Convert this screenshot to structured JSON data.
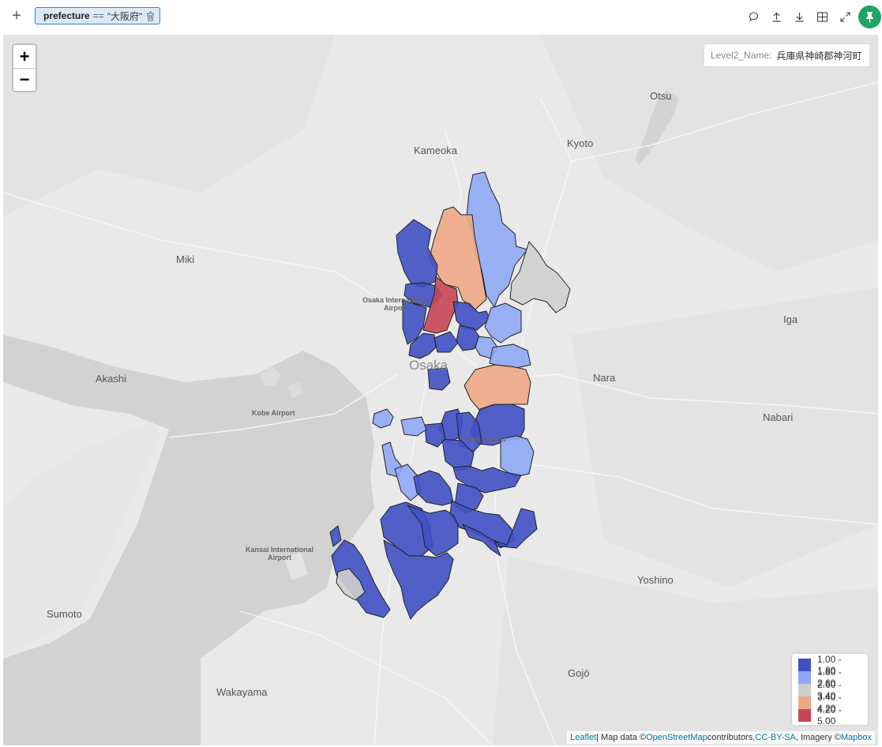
{
  "toolbar": {
    "add_label": "+",
    "filter": {
      "column": "prefecture",
      "operator": "==",
      "value": "\"大阪府\""
    },
    "icons": [
      "comment-icon",
      "upload-icon",
      "download-icon",
      "grid-icon",
      "expand-icon",
      "pin-icon"
    ]
  },
  "map": {
    "zoom_in": "+",
    "zoom_out": "−",
    "hover": {
      "key": "Level2_Name:",
      "value": "兵庫県神崎郡神河町"
    },
    "places": {
      "otsu": "Otsu",
      "kameoka": "Kameoka",
      "kyoto": "Kyoto",
      "miki": "Miki",
      "iga": "Iga",
      "osaka": "Osaka",
      "akashi": "Akashi",
      "nara": "Nara",
      "nabari": "Nabari",
      "kobe_airport": "Kobe Airport",
      "osaka_airport_1": "Osaka International",
      "osaka_airport_2": "Airport",
      "yao_airport": "Yao Airport",
      "kansai_airport_1": "Kansai International",
      "kansai_airport_2": "Airport",
      "yoshino": "Yoshino",
      "sumoto": "Sumoto",
      "gojo": "Gojō",
      "wakayama": "Wakayama"
    },
    "legend": [
      {
        "label": "1.00 - 1.80",
        "color": "#3f51c4"
      },
      {
        "label": "1.80 - 2.60",
        "color": "#8fa8f5"
      },
      {
        "label": "2.60 - 3.40",
        "color": "#cfcfcf"
      },
      {
        "label": "3.40 - 4.20",
        "color": "#eea785"
      },
      {
        "label": "4.20 - 5.00",
        "color": "#c64657"
      }
    ],
    "attribution": {
      "leaflet": "Leaflet",
      "sep1": " | Map data © ",
      "osm": "OpenStreetMap",
      "sep2": " contributors, ",
      "license": "CC-BY-SA",
      "sep3": ", Imagery © ",
      "mapbox": "Mapbox"
    }
  },
  "colors": {
    "accent": "#2f83c7",
    "pin": "#1fa463",
    "land": "#e9e9e9",
    "water": "#d0d0d0"
  }
}
